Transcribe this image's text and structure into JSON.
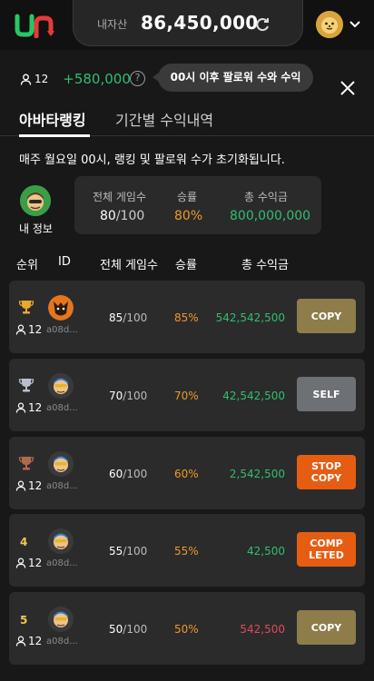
{
  "header": {
    "asset_label": "내자산",
    "asset_value": "86,450,000",
    "icons": [
      "logo-icon",
      "refresh-icon",
      "lion-avatar-icon",
      "chevron-down-icon"
    ]
  },
  "follower": {
    "count": "12",
    "profit": "+580,000",
    "help": "?",
    "tooltip": "00시 이후 팔로워 수와 수익"
  },
  "tabs": [
    {
      "label": "아바타랭킹",
      "active": true
    },
    {
      "label": "기간별 수익내역",
      "active": false
    }
  ],
  "notice": "매주 월요일 00시, 랭킹 및 팔로워 수가 초기화됩니다.",
  "my_info": {
    "label": "내 정보",
    "games_header": "전체 게임수",
    "winrate_header": "승률",
    "earnings_header": "총 수익금",
    "games_played": "80",
    "games_total": "/100",
    "winrate": "80%",
    "earnings": "800,000,000"
  },
  "columns": {
    "rank": "순위",
    "id": "ID",
    "games": "전체 게임수",
    "winrate": "승률",
    "earnings": "총 수익금"
  },
  "rows": [
    {
      "rank": "1",
      "medal": "gold",
      "followers": "12",
      "id": "a08d...",
      "games": "85",
      "total": "/100",
      "winrate": "85%",
      "earnings": "542,542,500",
      "earning_color": "#2fbf71",
      "action": "COPY",
      "action_type": "copy"
    },
    {
      "rank": "2",
      "medal": "silver",
      "followers": "12",
      "id": "a08d...",
      "games": "70",
      "total": "/100",
      "winrate": "70%",
      "earnings": "42,542,500",
      "earning_color": "#2fbf71",
      "action": "SELF",
      "action_type": "self"
    },
    {
      "rank": "3",
      "medal": "bronze",
      "followers": "12",
      "id": "a08d...",
      "games": "60",
      "total": "/100",
      "winrate": "60%",
      "earnings": "2,542,500",
      "earning_color": "#2fbf71",
      "action": "STOP COPY",
      "action_type": "stop"
    },
    {
      "rank": "4",
      "medal": "",
      "followers": "12",
      "id": "a08d...",
      "games": "55",
      "total": "/100",
      "winrate": "55%",
      "earnings": "42,500",
      "earning_color": "#2fbf71",
      "action": "COMP LETED",
      "action_type": "stop"
    },
    {
      "rank": "5",
      "medal": "",
      "followers": "12",
      "id": "a08d...",
      "games": "50",
      "total": "/100",
      "winrate": "50%",
      "earnings": "542,500",
      "earning_color": "#e04a5a",
      "action": "COPY",
      "action_type": "copy"
    }
  ],
  "colors": {
    "accent_green": "#2fbf71",
    "accent_orange": "#f0972a",
    "copy": "#8e7d4a",
    "self": "#6d7176",
    "stop": "#e65d12",
    "loss": "#e04a5a"
  }
}
